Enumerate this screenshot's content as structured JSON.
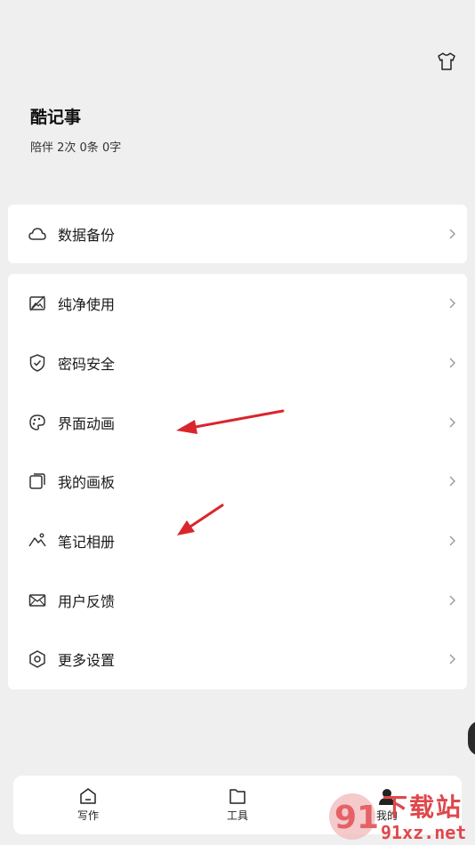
{
  "header": {
    "skin_icon": "tshirt-icon"
  },
  "profile": {
    "title": "酷记事",
    "stats": "陪伴 2次 0条 0字"
  },
  "backup_card": {
    "label": "数据备份",
    "icon": "cloud-icon"
  },
  "menu": {
    "items": [
      {
        "label": "纯净使用",
        "icon": "no-image-icon"
      },
      {
        "label": "密码安全",
        "icon": "shield-check-icon"
      },
      {
        "label": "界面动画",
        "icon": "palette-icon"
      },
      {
        "label": "我的画板",
        "icon": "canvas-icon"
      },
      {
        "label": "笔记相册",
        "icon": "mountain-icon"
      },
      {
        "label": "用户反馈",
        "icon": "envelope-icon"
      },
      {
        "label": "更多设置",
        "icon": "hexagon-gear-icon"
      }
    ]
  },
  "bottom_nav": {
    "items": [
      {
        "label": "写作",
        "icon": "home-icon"
      },
      {
        "label": "工具",
        "icon": "folder-icon"
      },
      {
        "label": "我的",
        "icon": "user-icon"
      }
    ]
  },
  "watermark": {
    "line1": "下载站",
    "line2": "91xz.net",
    "logo_text": "91"
  },
  "colors": {
    "background": "#efefef",
    "card": "#ffffff",
    "annotation_arrow": "#d9262c",
    "watermark": "#e0474b"
  }
}
